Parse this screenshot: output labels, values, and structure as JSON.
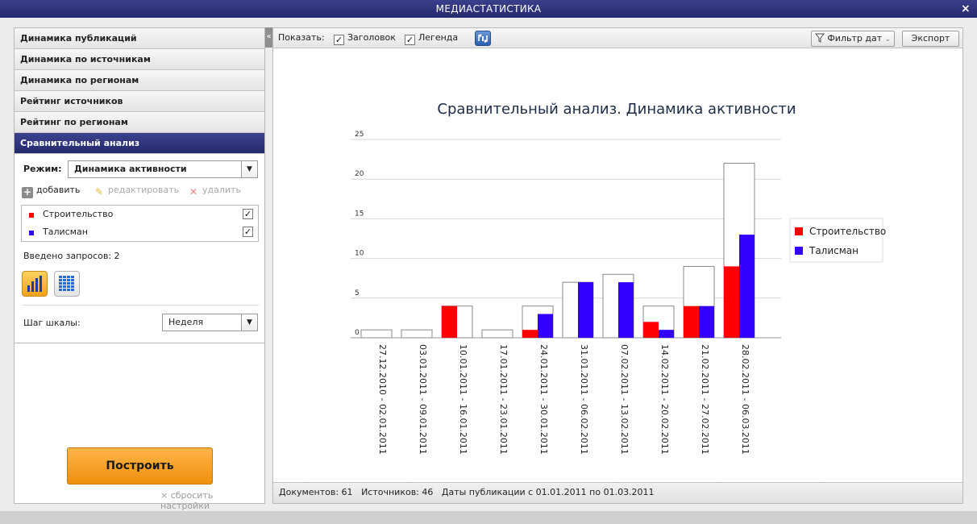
{
  "window": {
    "title": "МЕДИАСТАТИСТИКА",
    "close_glyph": "×"
  },
  "sidebar": {
    "items": [
      {
        "label": "Динамика публикаций"
      },
      {
        "label": "Динамика по источникам"
      },
      {
        "label": "Динамика по регионам"
      },
      {
        "label": "Рейтинг источников"
      },
      {
        "label": "Рейтинг по регионам"
      },
      {
        "label": "Сравнительный анализ",
        "active": true
      }
    ],
    "mode_label": "Режим:",
    "mode_value": "Динамика активности",
    "actions": {
      "add": "добавить",
      "edit": "редактировать",
      "delete": "удалить"
    },
    "queries": [
      {
        "label": "Строительство",
        "color": "#ff0000",
        "checked": true
      },
      {
        "label": "Талисман",
        "color": "#3300ff",
        "checked": true
      }
    ],
    "query_count": "Введено запросов: 2",
    "view_icons": {
      "chart": "bar-chart-icon",
      "table": "grid-table-icon"
    },
    "step_label": "Шаг шкалы:",
    "step_value": "Неделя",
    "build_label": "Построить",
    "reset_label": "сбросить настройки",
    "reset_glyph": "×"
  },
  "collapse_glyph": "«",
  "toolbar": {
    "show_label": "Показать:",
    "show_title_label": "Заголовок",
    "show_legend_label": "Легенда",
    "show_title_checked": true,
    "show_legend_checked": true,
    "refresh_icon": "refresh-icon",
    "date_filter_label": "Фильтр дат",
    "export_label": "Экспорт"
  },
  "status": {
    "documents": "Документов: 61",
    "sources": "Источников: 46",
    "dates": "Даты публикации с 01.01.2011 по 01.03.2011"
  },
  "chart_data": {
    "type": "bar",
    "title": "Сравнительный анализ. Динамика активности",
    "categories": [
      "27.12.2010 - 02.01.2011",
      "03.01.2011 - 09.01.2011",
      "10.01.2011 - 16.01.2011",
      "17.01.2011 - 23.01.2011",
      "24.01.2011 - 30.01.2011",
      "31.01.2011 - 06.02.2011",
      "07.02.2011 - 13.02.2011",
      "14.02.2011 - 20.02.2011",
      "21.02.2011 - 27.02.2011",
      "28.02.2011 - 06.03.2011"
    ],
    "series": [
      {
        "name": "Строительство",
        "color": "#ff0000",
        "values": [
          0,
          0,
          4,
          0,
          1,
          0,
          0,
          2,
          4,
          9
        ]
      },
      {
        "name": "Талисман",
        "color": "#3300ff",
        "values": [
          0,
          0,
          0,
          0,
          3,
          7,
          7,
          1,
          4,
          13
        ]
      }
    ],
    "totals": [
      1,
      1,
      4,
      1,
      4,
      7,
      8,
      4,
      9,
      22
    ],
    "ylim": [
      0,
      25
    ],
    "yticks": [
      0,
      5,
      10,
      15,
      20,
      25
    ],
    "grid": true,
    "legend": "right",
    "xlabel": "",
    "ylabel": ""
  }
}
